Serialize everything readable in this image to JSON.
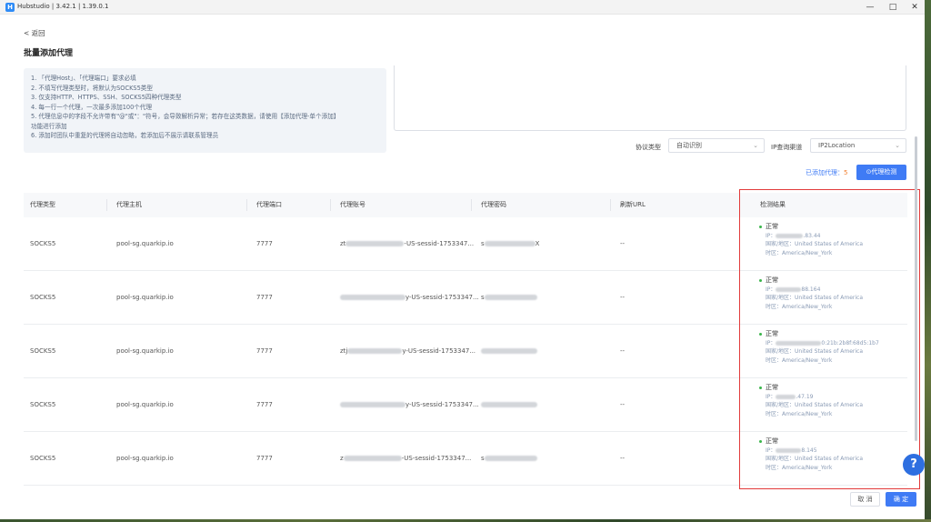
{
  "window": {
    "title": "Hubstudio | 3.42.1 | 1.39.0.1",
    "minimize_icon": "minimize-icon",
    "maximize_icon": "maximize-icon",
    "close_icon": "close-icon"
  },
  "header": {
    "back_label": "< 返回",
    "page_title": "批量添加代理"
  },
  "tips": [
    "1. 「代理Host」、「代理端口」要求必填",
    "2. 不填写代理类型时，将默认为SOCKS5类型",
    "3. 仅支持HTTP、HTTPS、SSH、SOCKS5四种代理类型",
    "4. 每一行一个代理，一次最多添加100个代理",
    "5. 代理信息中的字段不允许带有\"@\"或\"：\"符号，会导致解析异常；若存在这类数据，请使用【添加代理-单个添加】",
    "功能进行添加",
    "6. 添加时团队中重复的代理将自动忽略，若添加后不展示请联系管理员"
  ],
  "controls": {
    "protocol_label": "协议类型",
    "protocol_value": "自动识别",
    "ip_channel_label": "IP查询渠道",
    "ip_channel_value": "IP2Location",
    "added_label": "已添加代理：",
    "added_count": "5",
    "detect_button": "⊙代理检测"
  },
  "table": {
    "headers": [
      "代理类型",
      "代理主机",
      "代理端口",
      "代理账号",
      "代理密码",
      "刷新URL",
      "检测结果"
    ],
    "rows": [
      {
        "type": "SOCKS5",
        "host": "pool-sg.quarkip.io",
        "port": "7777",
        "account_prefix": "zt",
        "account_suffix": "-US-sessid-1753347...",
        "password_prefix": "s",
        "password_suffix": "X",
        "refresh": "--",
        "status": "正常",
        "ip": "IP：",
        "ip_tail": ".83.44",
        "country": "国家/地区：United States of America",
        "timezone": "时区：America/New_York"
      },
      {
        "type": "SOCKS5",
        "host": "pool-sg.quarkip.io",
        "port": "7777",
        "account_prefix": "",
        "account_suffix": "y-US-sessid-1753347...",
        "password_prefix": "s",
        "password_suffix": "",
        "refresh": "--",
        "status": "正常",
        "ip": "IP：",
        "ip_tail": "88.164",
        "country": "国家/地区：United States of America",
        "timezone": "时区：America/New_York"
      },
      {
        "type": "SOCKS5",
        "host": "pool-sg.quarkip.io",
        "port": "7777",
        "account_prefix": "ztj",
        "account_suffix": "y-US-sessid-1753347...",
        "password_prefix": "",
        "password_suffix": "",
        "refresh": "--",
        "status": "正常",
        "ip": "IP：",
        "ip_tail": "0:21b:2b8f:68d5:1b7",
        "country": "国家/地区：United States of America",
        "timezone": "时区：America/New_York"
      },
      {
        "type": "SOCKS5",
        "host": "pool-sg.quarkip.io",
        "port": "7777",
        "account_prefix": "",
        "account_suffix": "y-US-sessid-1753347...",
        "password_prefix": "",
        "password_suffix": "",
        "refresh": "--",
        "status": "正常",
        "ip": "IP：",
        "ip_tail": ".47.19",
        "country": "国家/地区：United States of America",
        "timezone": "时区：America/New_York"
      },
      {
        "type": "SOCKS5",
        "host": "pool-sg.quarkip.io",
        "port": "7777",
        "account_prefix": "z",
        "account_suffix": "-US-sessid-1753347...",
        "password_prefix": "s",
        "password_suffix": "",
        "refresh": "--",
        "status": "正常",
        "ip": "IP：",
        "ip_tail": "8.145",
        "country": "国家/地区：United States of America",
        "timezone": "时区：America/New_York"
      }
    ]
  },
  "footer": {
    "cancel_label": "取 消",
    "confirm_label": "确 定"
  },
  "help": {
    "label": "?"
  },
  "colors": {
    "accent": "#3f7bf5",
    "highlight": "#e23a3a",
    "success": "#3ab54a",
    "count": "#f27c2a"
  }
}
